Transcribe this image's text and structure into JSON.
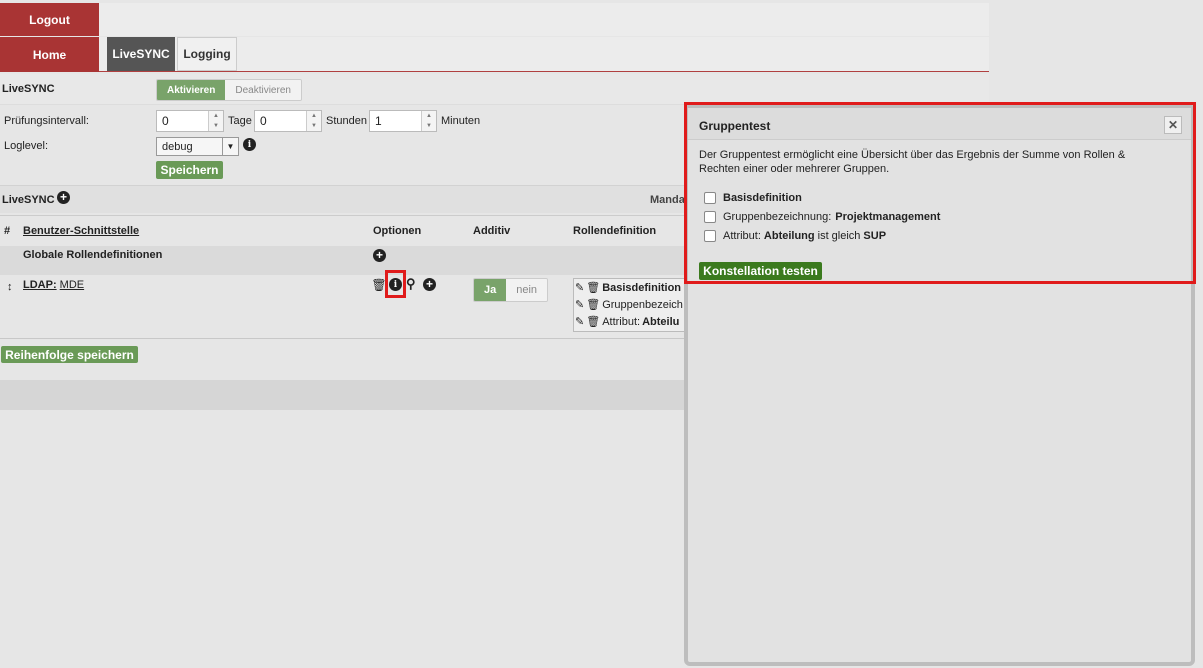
{
  "nav": {
    "logout": "Logout",
    "home": "Home"
  },
  "tabs": [
    {
      "label": "LiveSYNC"
    },
    {
      "label": "Logging"
    }
  ],
  "livesync_bar": {
    "label": "LiveSYNC",
    "activate": "Aktivieren",
    "deactivate": "Deaktivieren"
  },
  "settings": {
    "interval_label": "Prüfungsintervall:",
    "days_value": "0",
    "days_unit": "Tage",
    "hours_value": "0",
    "hours_unit": "Stunden",
    "minutes_value": "1",
    "minutes_unit": "Minuten",
    "loglevel_label": "Loglevel:",
    "loglevel_value": "debug",
    "save": "Speichern"
  },
  "section": {
    "label": "LiveSYNC",
    "right_label": "Manda"
  },
  "table": {
    "headers": {
      "hash": "#",
      "interface": "Benutzer-Schnittstelle",
      "options": "Optionen",
      "additive": "Additiv",
      "roles": "Rollendefinition"
    },
    "global_row": "Globale Rollendefinitionen",
    "ldap_row": {
      "prefix": "LDAP:",
      "name": "MDE",
      "toggle_on": "Ja",
      "toggle_off": "nein",
      "roles": [
        "Basisdefinition",
        "Gruppenbezeich",
        "Attribut:"
      ],
      "roles_bold_tail": "Abteilu"
    },
    "save_order": "Reihenfolge speichern"
  },
  "modal": {
    "title": "Gruppentest",
    "description": "Der Gruppentest ermöglicht eine Übersicht über das Ergebnis der Summe von Rollen & Rechten einer oder mehrerer Gruppen.",
    "options": {
      "basis": "Basisdefinition",
      "group_label": "Gruppenbezeichnung:",
      "group_value": "Projektmanagement",
      "attr_label": "Attribut:",
      "attr_key": "Abteilung",
      "attr_op": "ist gleich",
      "attr_value": "SUP"
    },
    "test_button": "Konstellation testen",
    "close_icon": "close-icon"
  },
  "colors": {
    "nav_red": "#a93434",
    "green": "#6a9a57",
    "dark_green": "#3b7a1e",
    "highlight_red": "#e01b1b"
  }
}
